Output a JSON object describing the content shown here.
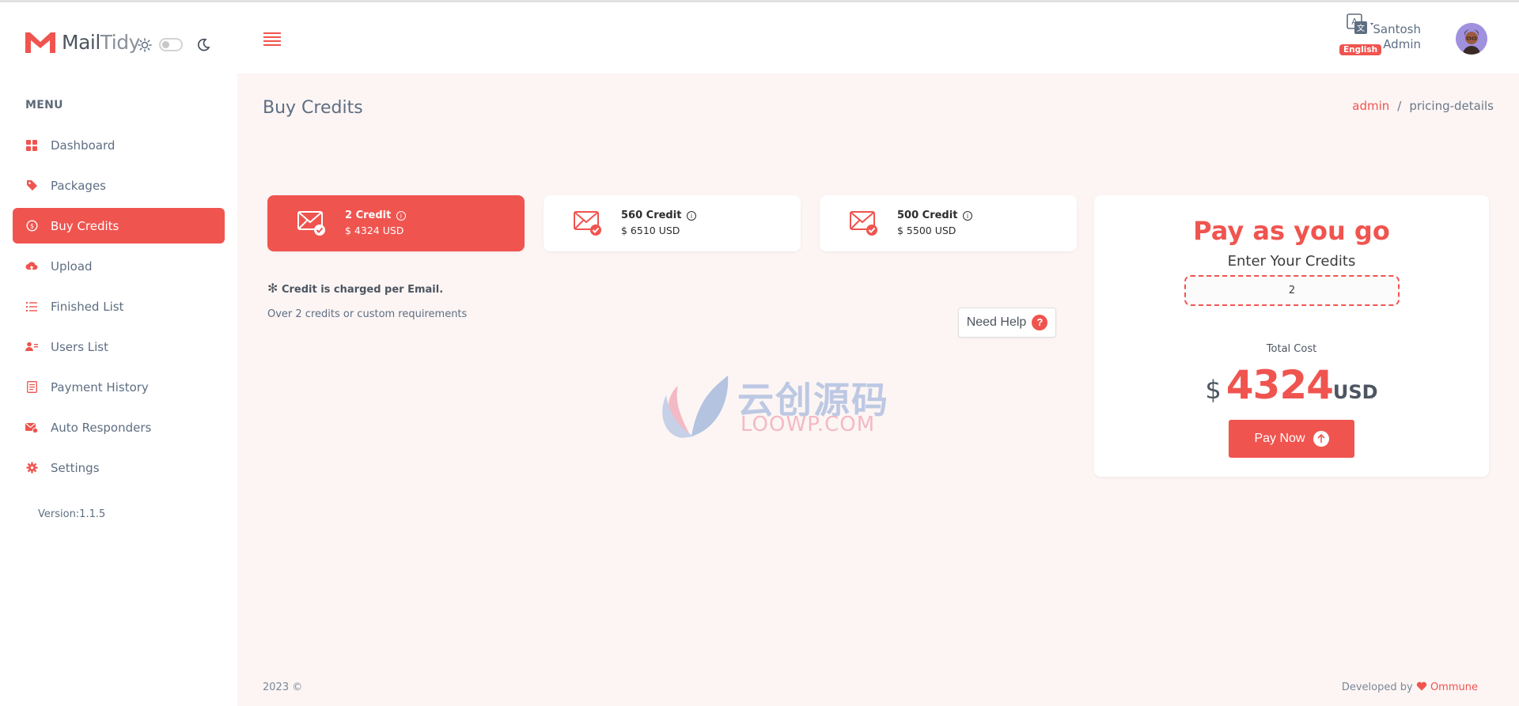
{
  "brand": {
    "name_part1": "Mail",
    "name_part2": "Tidy"
  },
  "sidebar": {
    "menu_title": "MENU",
    "items": [
      {
        "label": "Dashboard",
        "icon": "grid-icon"
      },
      {
        "label": "Packages",
        "icon": "tag-icon"
      },
      {
        "label": "Buy Credits",
        "icon": "coin-icon"
      },
      {
        "label": "Upload",
        "icon": "cloud-upload-icon"
      },
      {
        "label": "Finished List",
        "icon": "list-icon"
      },
      {
        "label": "Users List",
        "icon": "users-icon"
      },
      {
        "label": "Payment History",
        "icon": "receipt-icon"
      },
      {
        "label": "Auto Responders",
        "icon": "mail-reply-icon"
      },
      {
        "label": "Settings",
        "icon": "gear-icon"
      }
    ],
    "version": "Version:1.1.5"
  },
  "header": {
    "language": "English",
    "user_name": "Santosh",
    "user_role": "Admin"
  },
  "page": {
    "title": "Buy Credits",
    "breadcrumb": [
      "admin",
      "pricing-details"
    ]
  },
  "packages": [
    {
      "title": "2 Credit",
      "price": "$ 4324 USD"
    },
    {
      "title": "560 Credit",
      "price": "$ 6510 USD"
    },
    {
      "title": "500 Credit",
      "price": "$ 5500 USD"
    }
  ],
  "notes": {
    "charge": "Credit is charged per Email.",
    "custom": "Over 2 credits or custom requirements",
    "help_label": "Need Help",
    "help_mark": "?"
  },
  "pay": {
    "title": "Pay as you go",
    "enter_label": "Enter Your Credits",
    "credit_value": "2",
    "total_label": "Total Cost",
    "currency_symbol": "$",
    "amount": "4324",
    "currency": "USD",
    "button_label": "Pay Now"
  },
  "watermark": {
    "cn": "云创源码",
    "en": "LOOWP.COM"
  },
  "footer": {
    "left": "2023 ©",
    "developed_by": "Developed by",
    "company": "Ommune"
  },
  "colors": {
    "accent": "#f0544f",
    "background": "#fcf5f4",
    "text": "#5e6e82"
  }
}
